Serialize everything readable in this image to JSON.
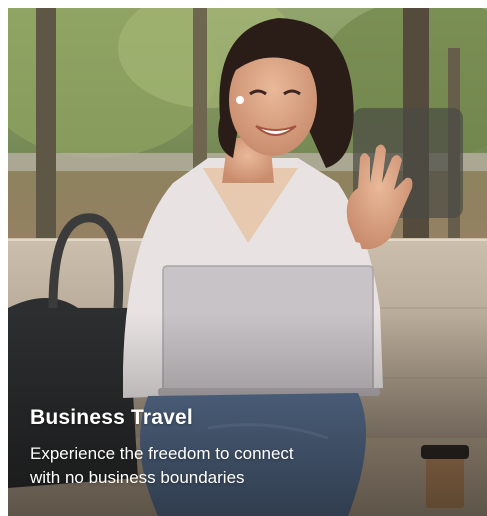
{
  "card": {
    "title": "Business Travel",
    "description_line1": "Experience the freedom to connect",
    "description_line2": "with no business boundaries"
  },
  "colors": {
    "text": "#ffffff",
    "foliage": "#7b8f5c",
    "bench": "#b9ab98",
    "laptop": "#c9c4c6",
    "jeans": "#5b7394",
    "shirt": "#e9e4e3"
  },
  "image": {
    "subject": "woman-waving-on-video-call-with-laptop"
  }
}
